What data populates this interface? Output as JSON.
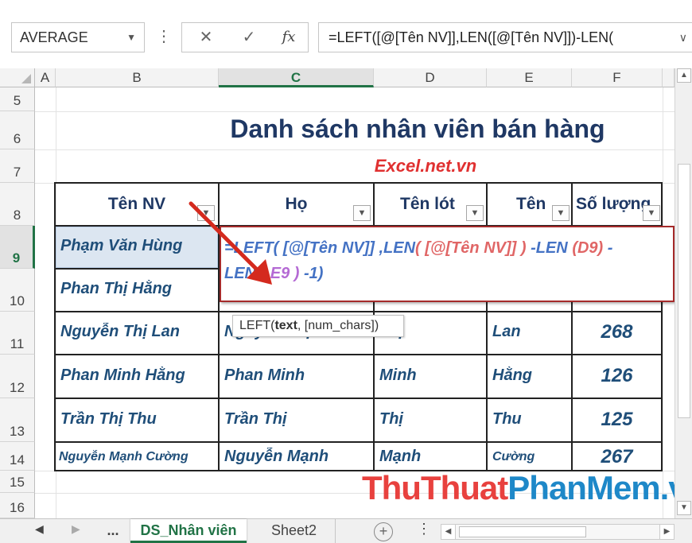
{
  "formula_bar": {
    "name_box": "AVERAGE",
    "cancel_icon": "✕",
    "enter_icon": "✓",
    "fx_label": "fx",
    "formula": "=LEFT([@[Tên NV]],LEN([@[Tên NV]])-LEN("
  },
  "columns": [
    "A",
    "B",
    "C",
    "D",
    "E",
    "F"
  ],
  "rows": [
    "5",
    "6",
    "7",
    "8",
    "9",
    "10",
    "11",
    "12",
    "13",
    "14",
    "15",
    "16"
  ],
  "sheet": {
    "title": "Danh sách nhân viên bán hàng",
    "subtitle": "Excel.net.vn",
    "headers": {
      "ten_nv": "Tên NV",
      "ho": "Họ",
      "ten_lot": "Tên lót",
      "ten": "Tên",
      "so_luong": "Số lượng"
    },
    "table_rows": [
      {
        "ten_nv": "Phạm Văn Hùng",
        "ho": "",
        "ten_lot": "",
        "ten": "",
        "so_luong": ""
      },
      {
        "ten_nv": "Phan Thị Hằng",
        "ho": "",
        "ten_lot": "",
        "ten": "",
        "so_luong": ""
      },
      {
        "ten_nv": "Nguyễn Thị Lan",
        "ho": "Nguyễn Thị",
        "ten_lot": "Thị",
        "ten": "Lan",
        "so_luong": "268"
      },
      {
        "ten_nv": "Phan Minh Hằng",
        "ho": "Phan Minh",
        "ten_lot": "Minh",
        "ten": "Hằng",
        "so_luong": "126"
      },
      {
        "ten_nv": "Trần Thị Thu",
        "ho": "Trần Thị",
        "ten_lot": "Thị",
        "ten": "Thu",
        "so_luong": "125"
      },
      {
        "ten_nv": "Nguyễn Mạnh Cường",
        "ho": "Nguyễn Mạnh",
        "ten_lot": "Mạnh",
        "ten": "Cường",
        "so_luong": "267"
      }
    ]
  },
  "editor": {
    "line1_a": "=LEFT( [@[Tên NV]] ,LEN",
    "line1_b": "( [@[Tên NV]] )",
    "line1_c": " -LEN ",
    "line1_d": "(D9)",
    "line1_e": " -",
    "line2_a": "LEN ",
    "line2_b": "( E9 )",
    "line2_c": " -1)"
  },
  "tooltip": {
    "fn": "LEFT(",
    "arg1": "text",
    "rest": ", [num_chars])"
  },
  "tabs": {
    "ellipsis": "...",
    "active": "DS_Nhân viên",
    "other": "Sheet2",
    "add": "+"
  },
  "watermark": {
    "part1": "ThuThuat",
    "part2": "PhanMem",
    "part3": ".vn"
  },
  "colors": {
    "excel_green": "#217346",
    "title_blue": "#1f3864",
    "subtitle_red": "#e03030",
    "arrow_red": "#d42a1e",
    "editor_border": "#a52a2a"
  }
}
